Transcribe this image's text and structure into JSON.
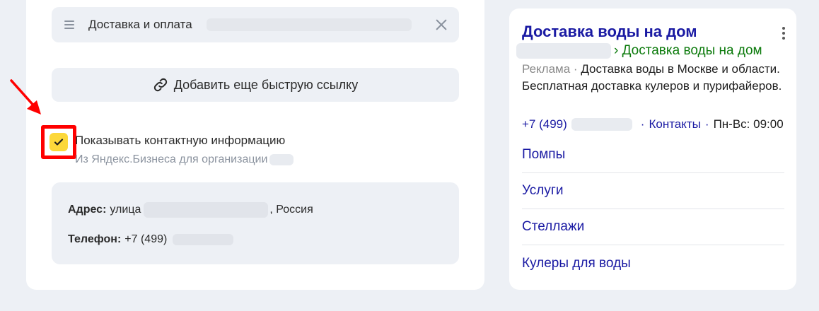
{
  "editor": {
    "quick_link_title": "Доставка и оплата",
    "add_link_button": "Добавить еще быструю ссылку",
    "show_contacts_label": "Показывать контактную информацию",
    "show_contacts_checked": true,
    "contacts_source": "Из Яндекс.Бизнеса для организации",
    "address_label": "Адрес:",
    "address_prefix": "улица",
    "address_suffix": ", Россия",
    "phone_label": "Телефон:",
    "phone_prefix": "+7 (499)"
  },
  "ad_preview": {
    "title": "Доставка воды на дом",
    "url_path": "› Доставка воды на дом",
    "ad_label": "Реклама ·",
    "description": "Доставка воды в Москве и области. Бесплатная доставка кулеров и пурифайеров.",
    "phone_prefix": "+7 (499)",
    "contacts_link": "Контакты",
    "separator": "·",
    "hours": "Пн-Вс: 09:00",
    "sitelinks": [
      {
        "label": "Помпы"
      },
      {
        "label": "Услуги"
      },
      {
        "label": "Стеллажи"
      },
      {
        "label": "Кулеры для воды"
      }
    ]
  },
  "colors": {
    "accent_link": "#1a1aa3",
    "url_green": "#0b7a0b",
    "checkbox_yellow": "#fcd83a",
    "highlight_red": "#ff0000"
  }
}
